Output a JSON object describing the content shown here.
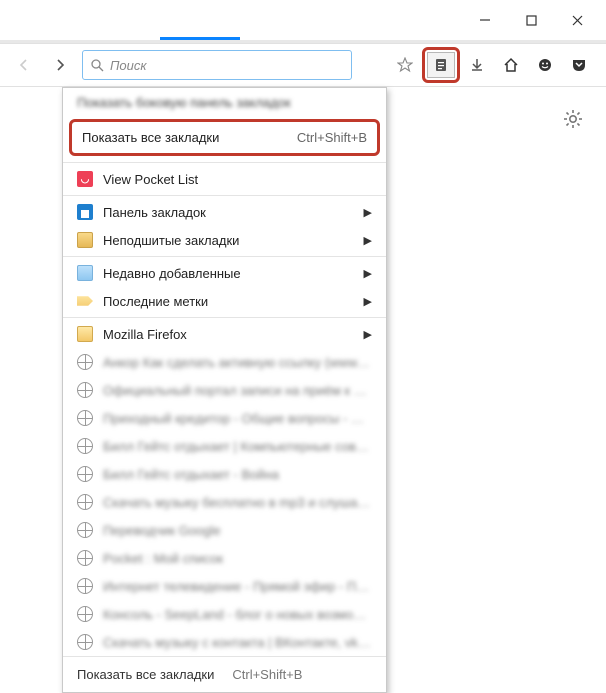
{
  "titlebar": {
    "minimize": "—",
    "maximize": "▢",
    "close": "✕"
  },
  "toolbar": {
    "search_placeholder": "Поиск"
  },
  "menu": {
    "blurred_top": "Показать боковую панель закладок",
    "show_all": {
      "label": "Показать все закладки",
      "shortcut": "Ctrl+Shift+B"
    },
    "pocket": "View Pocket List",
    "panel": "Панель закладок",
    "unsorted": "Неподшитые закладки",
    "recent_added": "Недавно добавленные",
    "recent_tags": "Последние метки",
    "mozilla": "Mozilla Firefox",
    "blurred_items": [
      "Анкор Как сделать активную ссылку (www.Nef…",
      "Официальный портал записи на приём к врачу…",
      "Приходный кредитор - Общие вопросы - Ме…",
      "Билл Гейтс отдыхает | Компьютерные советы",
      "Билл Гейтс отдыхает - Война",
      "Скачать музыку бесплатно в mp3 и слушать онл…",
      "Переводчик Google",
      "Pocket : Мой список",
      "Интернет телевидение - Прямой эфир - Первый…",
      "Консоль - SeepLand - блог о новых возможност…",
      "Скачать музыку с контакта | ВКонтакте, vk.com…"
    ],
    "footer": {
      "label": "Показать все закладки",
      "shortcut": "Ctrl+Shift+B"
    }
  }
}
